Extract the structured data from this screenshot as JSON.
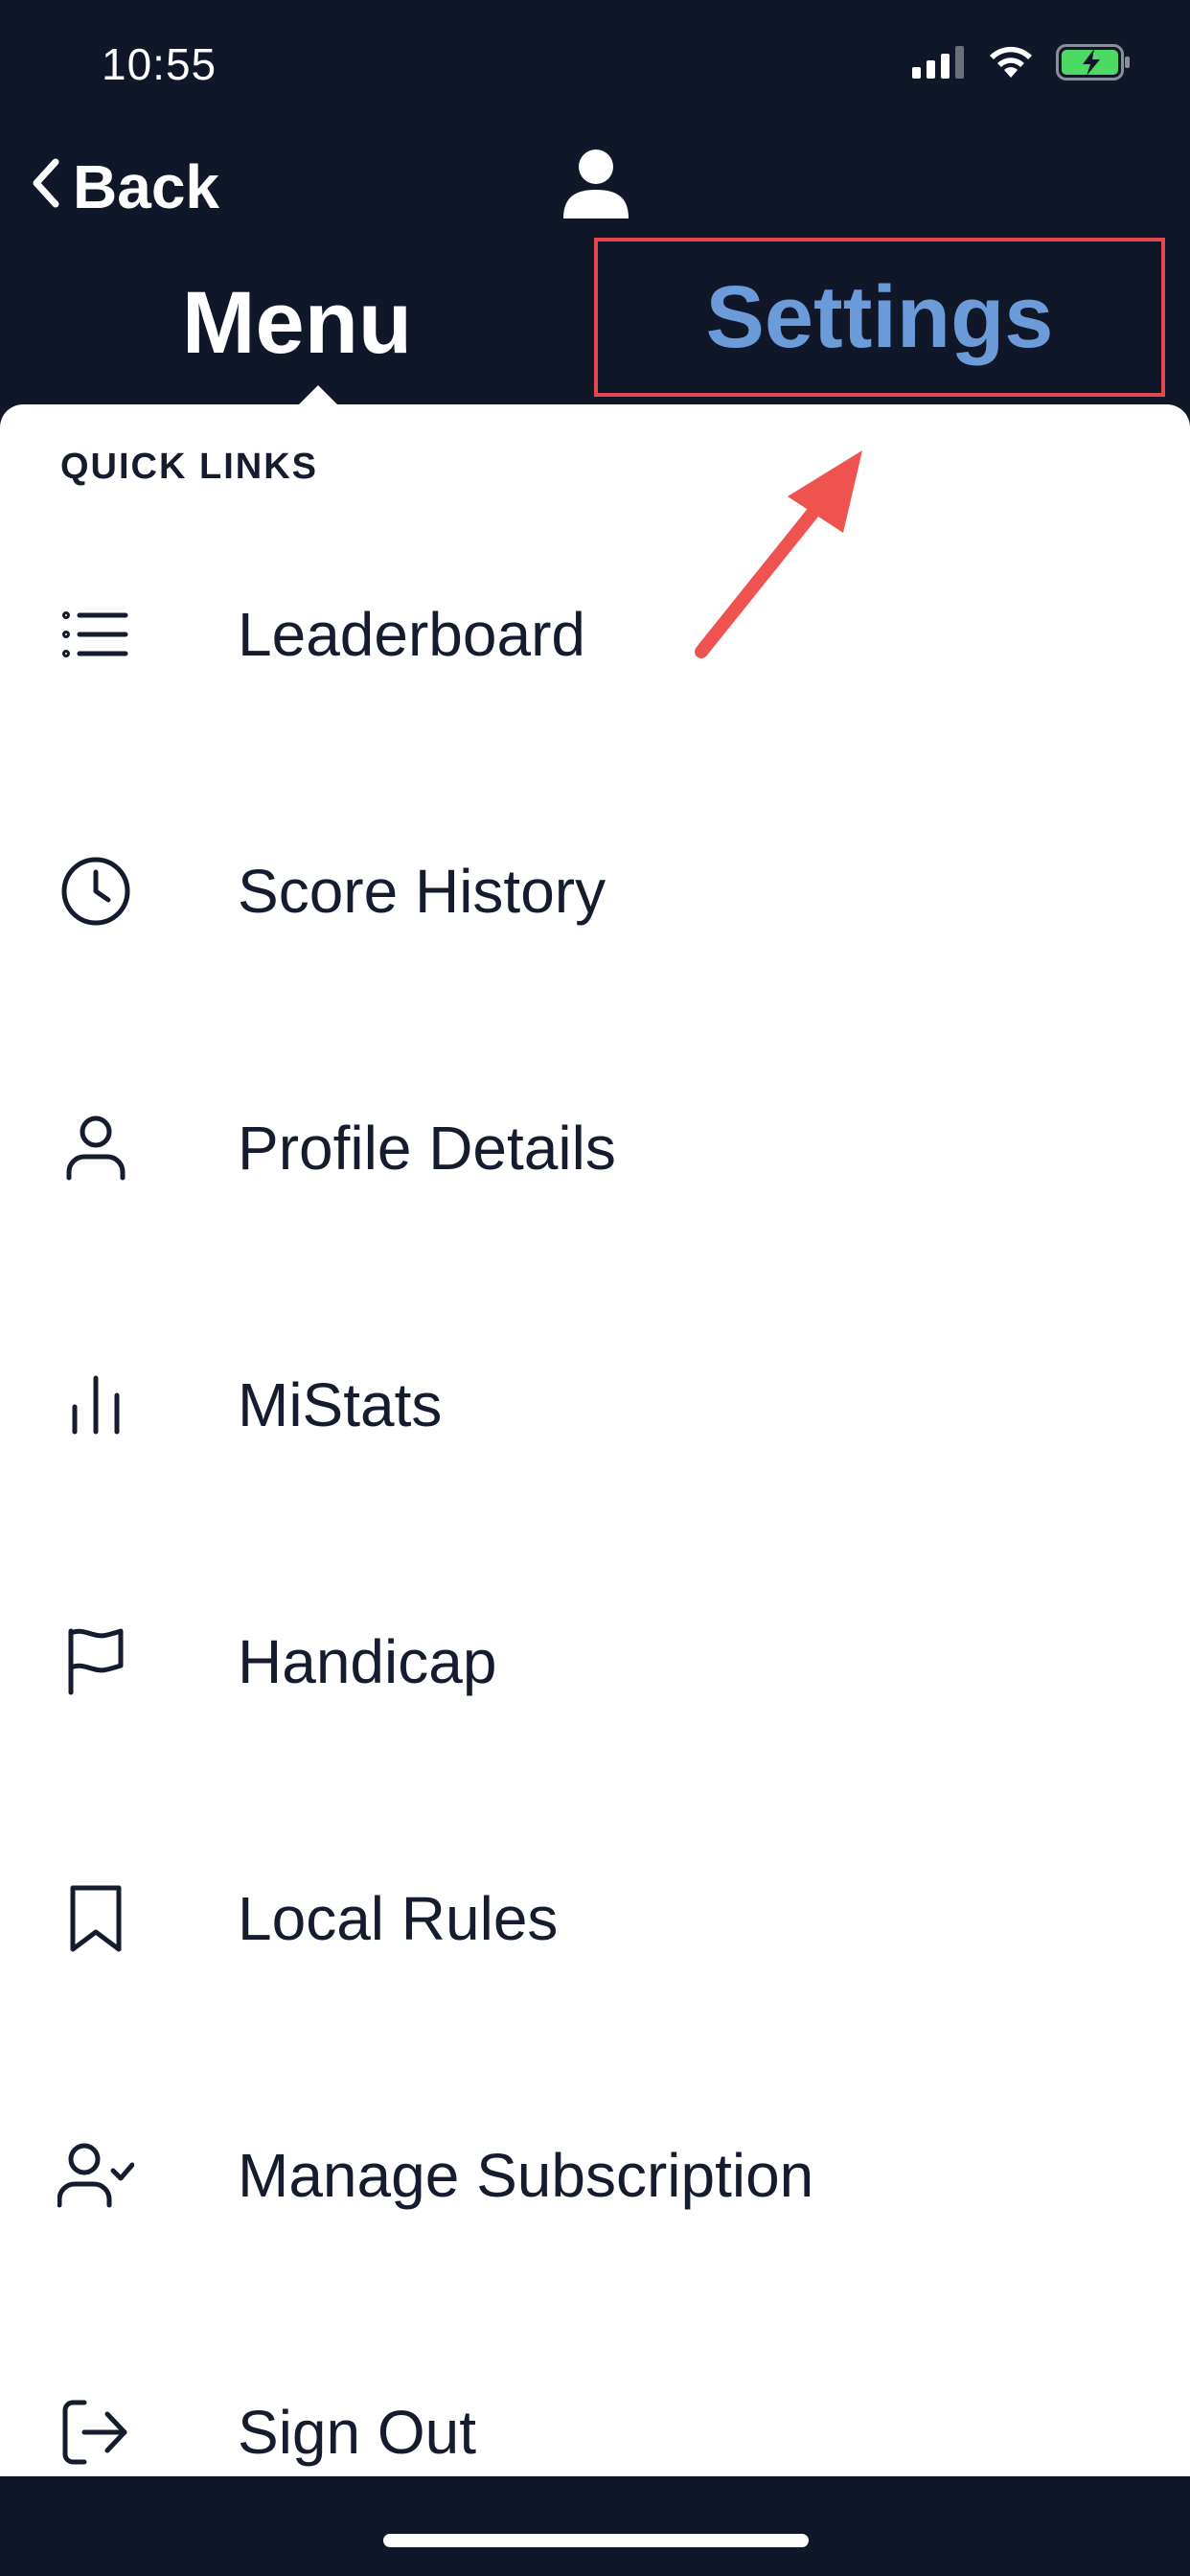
{
  "status_bar": {
    "time": "10:55"
  },
  "nav": {
    "back_label": "Back",
    "tab_menu": "Menu",
    "tab_settings": "Settings"
  },
  "section_title": "QUICK LINKS",
  "menu_items": [
    {
      "label": "Leaderboard",
      "icon": "list-icon"
    },
    {
      "label": "Score History",
      "icon": "clock-icon"
    },
    {
      "label": "Profile Details",
      "icon": "user-icon"
    },
    {
      "label": "MiStats",
      "icon": "bar-chart-icon"
    },
    {
      "label": "Handicap",
      "icon": "flag-icon"
    },
    {
      "label": "Local Rules",
      "icon": "bookmark-icon"
    },
    {
      "label": "Manage Subscription",
      "icon": "user-check-icon"
    },
    {
      "label": "Sign Out",
      "icon": "sign-out-icon"
    }
  ],
  "colors": {
    "header_bg": "#101729",
    "settings_tab": "#6b9bd8",
    "highlight_box": "#e5484d",
    "annotation_arrow": "#ef5350",
    "text": "#141c2e"
  }
}
